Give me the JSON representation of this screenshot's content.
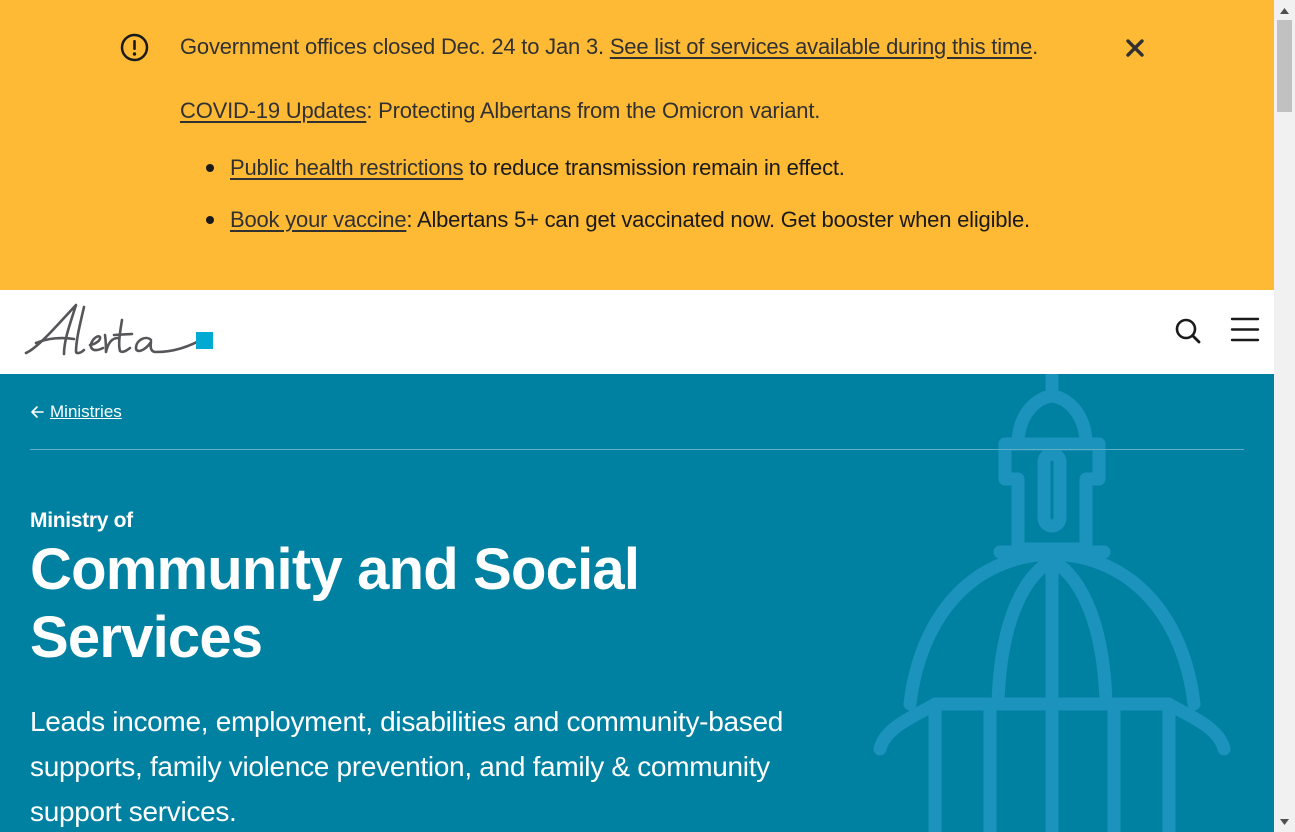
{
  "alert": {
    "icon": "exclamation-circle-icon",
    "closed_text": "Government offices closed Dec. 24 to Jan 3. ",
    "closed_link": "See list of services available during this time",
    "closed_end": ".",
    "covid_link": "COVID-19 Updates",
    "covid_text": ": Protecting Albertans from the Omicron variant.",
    "bullets": [
      {
        "link": "Public health restrictions",
        "text": " to reduce transmission remain in effect."
      },
      {
        "link": "Book your vaccine",
        "text": ": Albertans 5+ can get vaccinated now. Get booster when eligible."
      }
    ],
    "close_icon": "close-icon",
    "background": "#feba35"
  },
  "header": {
    "logo_alt": "Alberta",
    "search_icon": "search-icon",
    "menu_icon": "hamburger-menu-icon"
  },
  "hero": {
    "breadcrumb": "Ministries",
    "eyebrow": "Ministry of",
    "title": "Community and Social Services",
    "description": "Leads income, employment, disabilities and community-based supports, family violence prevention, and family & community support services.",
    "background": "#0081a2",
    "decoration_icon": "legislature-dome-icon"
  }
}
